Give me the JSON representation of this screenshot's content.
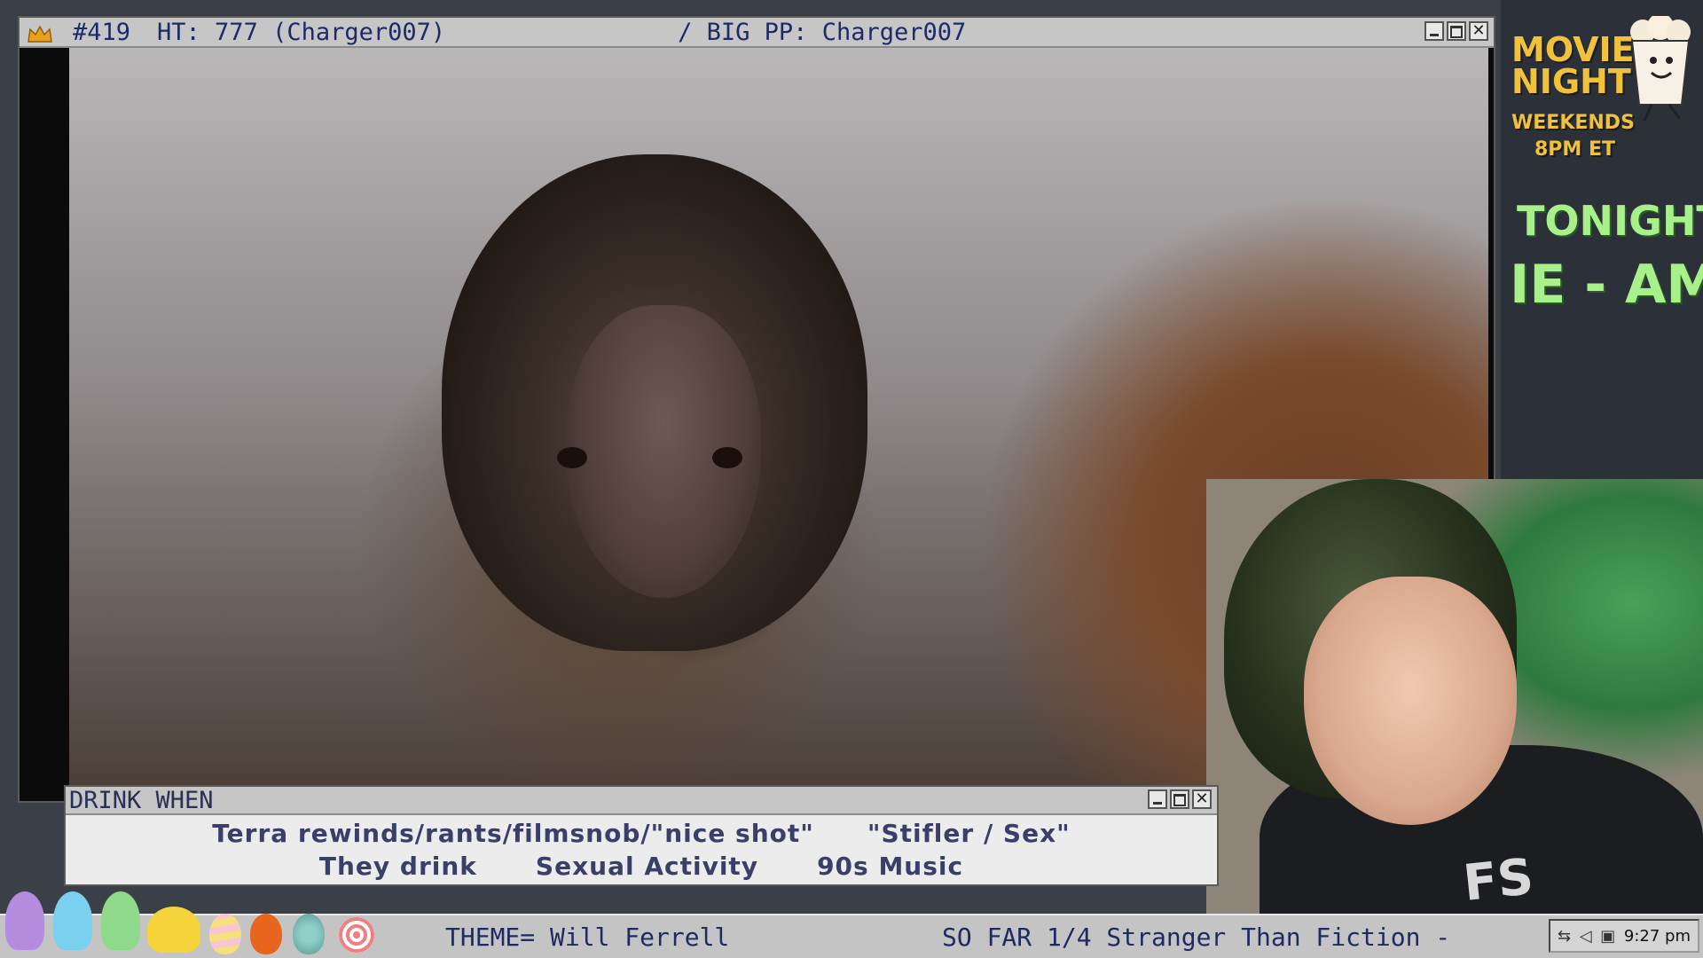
{
  "main_window": {
    "title_number": "#419",
    "title_ht": "HT: 777 (Charger007)",
    "title_bigpp": "/ BIG PP: Charger007",
    "title_icon": "crown-icon"
  },
  "side_panel": {
    "promo_line1": "MOVIE",
    "promo_line2": "NIGHT",
    "promo_line3": "WEEKENDS",
    "promo_line4": "8PM ET",
    "tonight_label": "TONIGHT:",
    "tonight_scroll": "IE - AM",
    "mascot_icon": "popcorn-mascot-icon"
  },
  "drink_window": {
    "title": "DRINK WHEN",
    "rules_row1": [
      "Terra rewinds/rants/filmsnob/\"nice shot\"",
      "\"Stifler / Sex\""
    ],
    "rules_row2": [
      "They drink",
      "Sexual Activity",
      "90s Music"
    ]
  },
  "bottom_bar": {
    "theme_text": "THEME= Will Ferrell",
    "so_far_text": "SO FAR 1/4 Stranger Than Fiction -",
    "clock": "9:27 pm",
    "decor_icons": [
      "purple-bunny-icon",
      "blue-bunny-icon",
      "green-bunny-icon",
      "yellow-chick-icon",
      "striped-egg-icon",
      "orange-egg-icon",
      "teal-egg-icon",
      "spiral-candy-icon"
    ],
    "colors": {
      "purple": "#b58be0",
      "blue": "#7ad0ef",
      "green": "#8fd98a",
      "yellow": "#f5d43a",
      "orange": "#e8651e",
      "teal": "#6fb8b0",
      "pink": "#f08080"
    }
  }
}
